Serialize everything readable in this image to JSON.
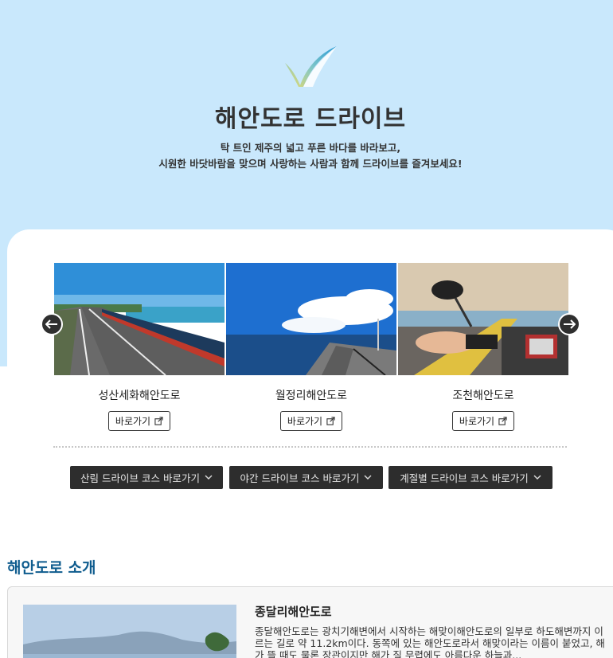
{
  "hero": {
    "title": "해안도로 드라이브",
    "desc_line1": "탁 트인 제주의 넓고 푸른 바다를 바라보고,",
    "desc_line2": "시원한 바닷바람을 맞으며 사랑하는 사람과 함께 드라이브를 즐겨보세요!"
  },
  "slider": {
    "items": [
      {
        "name": "성산세화해안도로",
        "button": "바로가기"
      },
      {
        "name": "월정리해안도로",
        "button": "바로가기"
      },
      {
        "name": "조천해안도로",
        "button": "바로가기"
      }
    ]
  },
  "course_buttons": [
    {
      "label": "산림 드라이브 코스 바로가기"
    },
    {
      "label": "야간 드라이브 코스 바로가기"
    },
    {
      "label": "계절별 드라이브 코스 바로가기"
    }
  ],
  "intro": {
    "section_title": "해안도로 소개",
    "card_title": "종달리해안도로",
    "card_text": "종달해안도로는 광치기해변에서 시작하는 해맞이해안도로의 일부로 하도해변까지 이르는 길로 약 11.2km이다. 동쪽에 있는 해안도로라서 해맞이라는 이름이 붙었고, 해가 뜰 때도 물론 장관이지만 해가 질 무렵에도 아름다운 하늘과..."
  },
  "colors": {
    "hero_bg": "#c9e8fc",
    "section_title": "#0f5c8e",
    "dark_button": "#2d2d2d"
  },
  "icons": [
    "check-logo-icon",
    "arrow-left-icon",
    "arrow-right-icon",
    "external-link-icon",
    "chevron-down-icon"
  ]
}
